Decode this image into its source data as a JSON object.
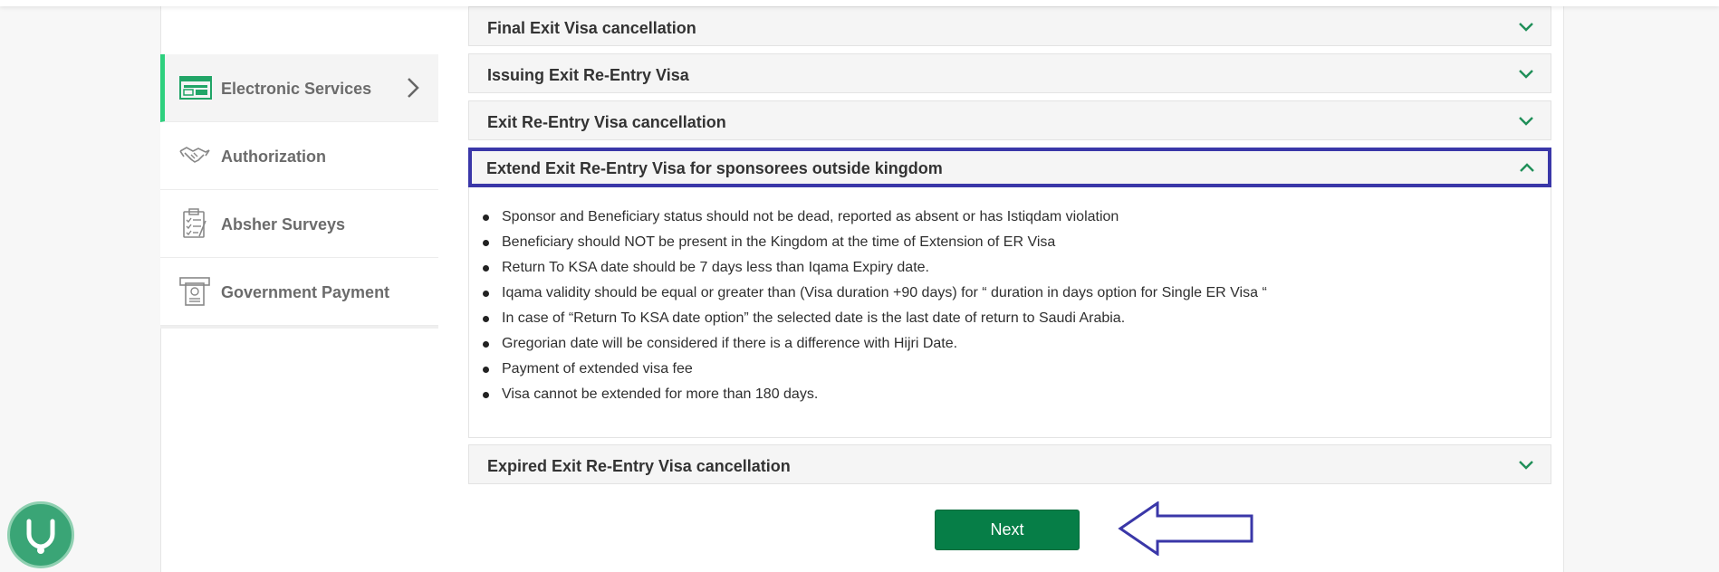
{
  "sidebar": {
    "items": [
      {
        "label": "Electronic Services",
        "icon": "electronic-services-icon",
        "active": true
      },
      {
        "label": "Authorization",
        "icon": "handshake-icon",
        "active": false
      },
      {
        "label": "Absher Surveys",
        "icon": "clipboard-checklist-icon",
        "active": false
      },
      {
        "label": "Government Payment",
        "icon": "atm-payment-icon",
        "active": false
      }
    ]
  },
  "accordion": {
    "items": [
      {
        "title": "Final Exit Visa cancellation",
        "open": false
      },
      {
        "title": "Issuing Exit Re-Entry Visa",
        "open": false
      },
      {
        "title": "Exit Re-Entry Visa cancellation",
        "open": false
      },
      {
        "title": "Extend Exit Re-Entry Visa for sponsorees outside kingdom",
        "open": true
      },
      {
        "title": "Expired Exit Re-Entry Visa cancellation",
        "open": false
      }
    ],
    "open_rules": [
      "Sponsor and Beneficiary status should not be dead, reported as absent or has Istiqdam violation",
      "Beneficiary should NOT be present in the Kingdom at the time of Extension of ER Visa",
      "Return To KSA date should be 7 days less than Iqama Expiry date.",
      "Iqama validity should be equal or greater than (Visa duration +90 days) for “ duration in days option for Single ER Visa “",
      "In case of “Return To KSA date option” the selected date is the last date of return to Saudi Arabia.",
      "Gregorian date will be considered if there is a difference with Hijri Date.",
      "Payment of extended visa fee",
      "Visa cannot be extended for more than 180 days."
    ]
  },
  "actions": {
    "next_label": "Next"
  },
  "colors": {
    "accent_green": "#067e47",
    "active_marker": "#2ed07e",
    "highlight_border": "#3a37a8",
    "annotation_arrow": "#3a37a8"
  },
  "support_widget": {
    "icon": "stethoscope-support-icon"
  }
}
